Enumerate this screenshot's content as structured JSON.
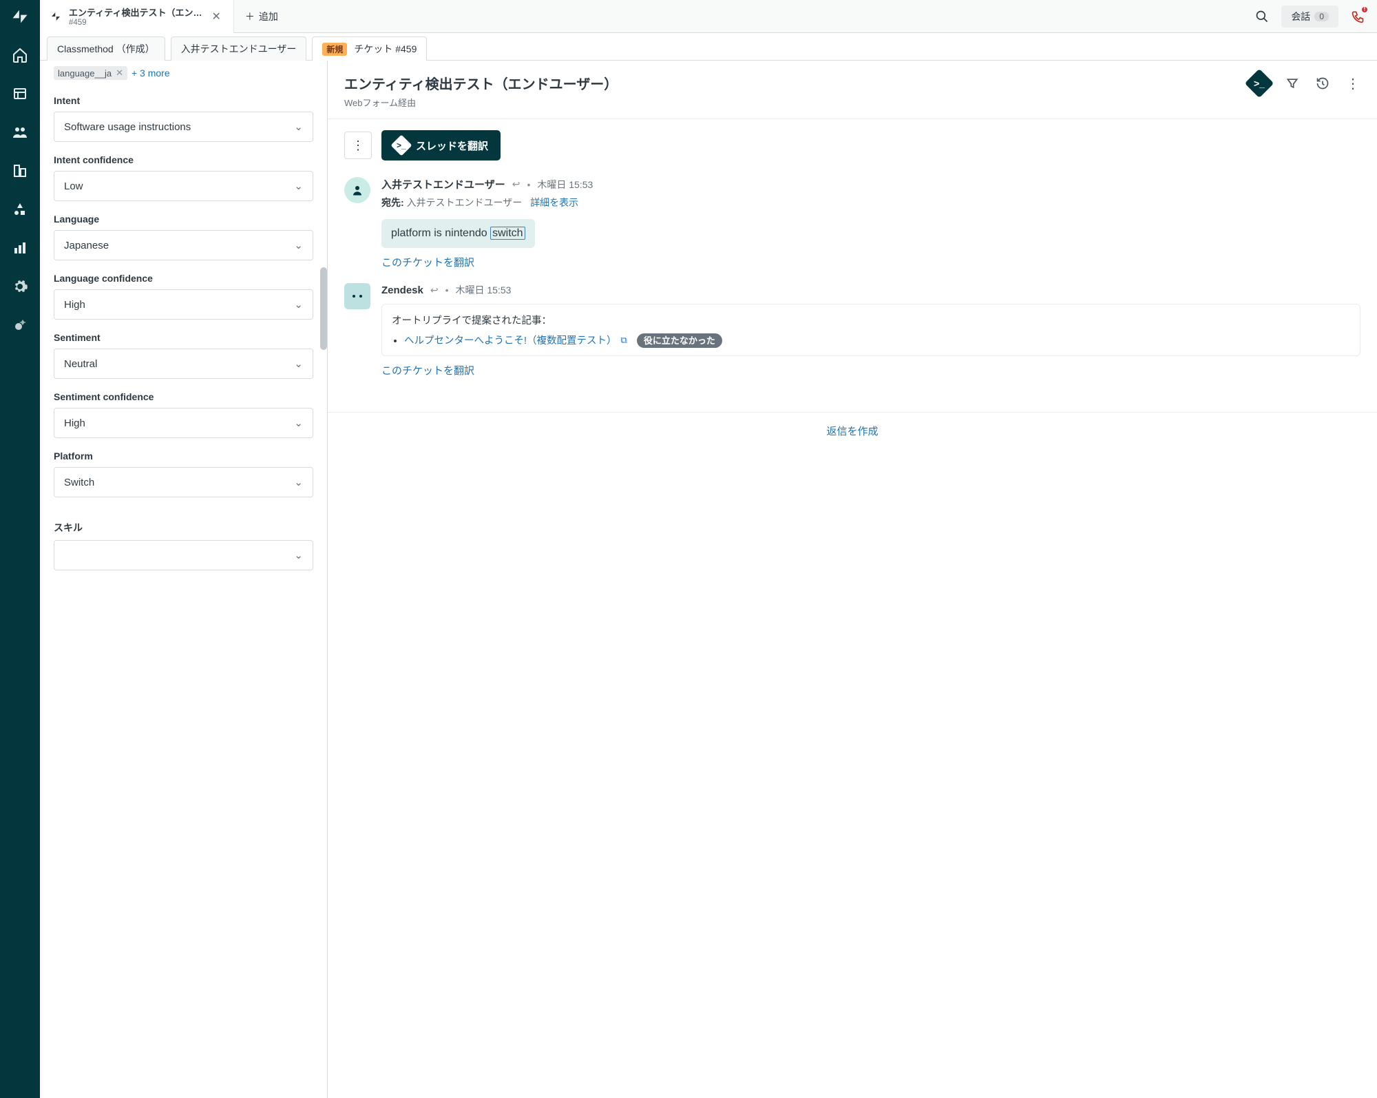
{
  "tab": {
    "title": "エンティティ検出テスト（エン…",
    "sub": "#459",
    "add": "追加"
  },
  "top": {
    "convo": "会話",
    "convo_count": "0"
  },
  "subtabs": {
    "a": "Classmethod （作成）",
    "b": "入井テストエンドユーザー",
    "status": "新規",
    "c": "チケット #459"
  },
  "side": {
    "tag": "language__ja",
    "more": "+ 3 more",
    "intent_lbl": "Intent",
    "intent_val": "Software usage instructions",
    "intent_conf_lbl": "Intent confidence",
    "intent_conf_val": "Low",
    "lang_lbl": "Language",
    "lang_val": "Japanese",
    "lang_conf_lbl": "Language confidence",
    "lang_conf_val": "High",
    "sent_lbl": "Sentiment",
    "sent_val": "Neutral",
    "sent_conf_lbl": "Sentiment confidence",
    "sent_conf_val": "High",
    "platform_lbl": "Platform",
    "platform_val": "Switch",
    "skill_lbl": "スキル",
    "skill_val": ""
  },
  "conv": {
    "title": "エンティティ検出テスト（エンドユーザー）",
    "via": "Webフォーム経由",
    "translate_btn": "スレッドを翻訳",
    "compose": "返信を作成"
  },
  "m1": {
    "author": "入井テストエンドユーザー",
    "time": "木曜日 15:53",
    "rcpt_lbl": "宛先:",
    "rcpt_val": "入井テストエンドユーザー",
    "detail": "詳細を表示",
    "text_pre": "platform is nintendo ",
    "text_hilite": "switch",
    "translate": "このチケットを翻訳"
  },
  "m2": {
    "author": "Zendesk",
    "time": "木曜日 15:53",
    "autoreply": "オートリプライで提案された記事：",
    "article": "ヘルプセンターへようこそ!（複数配置テスト）",
    "unhelpful": "役に立たなかった",
    "translate": "このチケットを翻訳"
  }
}
